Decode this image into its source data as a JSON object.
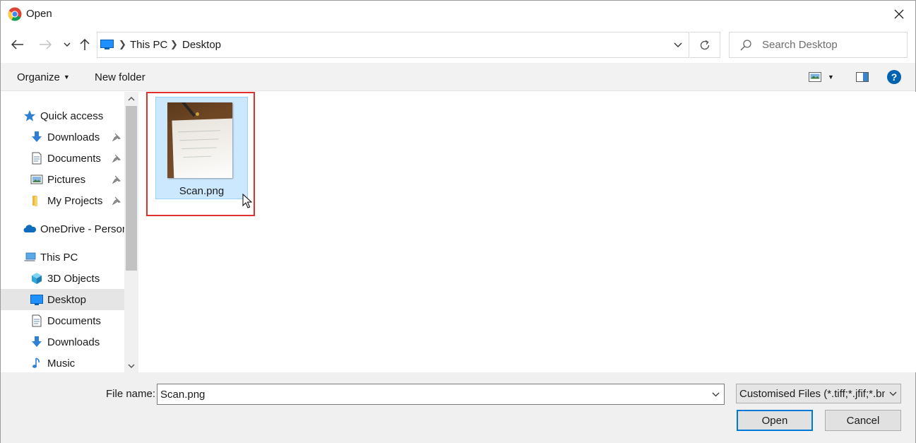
{
  "window": {
    "title": "Open",
    "app_icon": "chrome-icon"
  },
  "navigation": {
    "back_icon": "back-arrow-icon",
    "forward_icon": "forward-arrow-icon",
    "recent_icon": "chevron-down-icon",
    "up_icon": "up-arrow-icon",
    "breadcrumb": [
      "This PC",
      "Desktop"
    ],
    "refresh_icon": "refresh-icon",
    "search_placeholder": "Search Desktop"
  },
  "commandbar": {
    "organize": "Organize",
    "new_folder": "New folder",
    "help": "?"
  },
  "sidebar": {
    "items": [
      {
        "label": "Quick access",
        "icon": "star-icon",
        "pinned": false
      },
      {
        "label": "Downloads",
        "icon": "download-icon",
        "pinned": true
      },
      {
        "label": "Documents",
        "icon": "document-icon",
        "pinned": true
      },
      {
        "label": "Pictures",
        "icon": "pictures-icon",
        "pinned": true
      },
      {
        "label": "My Projects",
        "icon": "folder-icon",
        "pinned": true
      },
      {
        "label": "OneDrive - Person",
        "icon": "cloud-icon",
        "pinned": false
      },
      {
        "label": "This PC",
        "icon": "computer-icon",
        "pinned": false
      },
      {
        "label": "3D Objects",
        "icon": "cube-icon",
        "pinned": false
      },
      {
        "label": "Desktop",
        "icon": "desktop-icon",
        "pinned": false,
        "selected": true
      },
      {
        "label": "Documents",
        "icon": "document-icon",
        "pinned": false
      },
      {
        "label": "Downloads",
        "icon": "download-icon",
        "pinned": false
      },
      {
        "label": "Music",
        "icon": "music-icon",
        "pinned": false
      }
    ]
  },
  "files": [
    {
      "name": "Scan.png",
      "selected": true,
      "icon": "image-thumbnail"
    }
  ],
  "bottom": {
    "file_name_label": "File name:",
    "file_name_value": "Scan.png",
    "file_type": "Customised Files (*.tiff;*.jfif;*.bmp;*.gif;*.png)",
    "open_label": "Open",
    "cancel_label": "Cancel"
  },
  "colors": {
    "selection": "#cce8ff",
    "selection_border": "#99d1ff",
    "highlight": "#e03131",
    "accent": "#0078d7"
  }
}
